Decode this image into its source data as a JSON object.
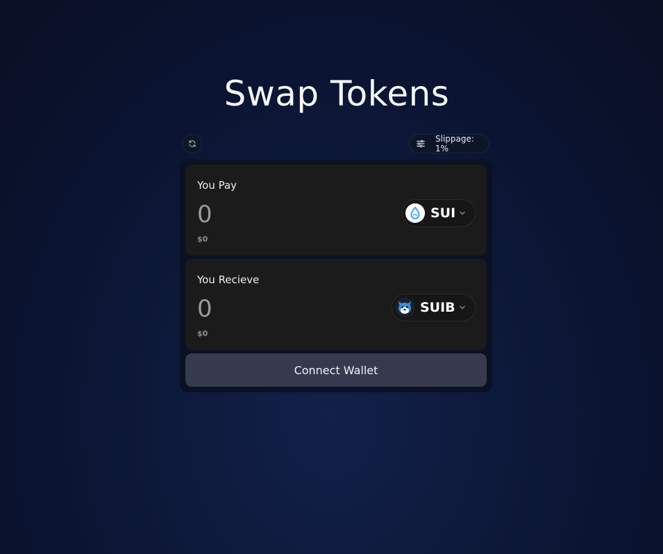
{
  "title": "Swap Tokens",
  "toolbar": {
    "refresh_icon": "refresh-icon",
    "slippage_icon": "sliders-icon",
    "slippage_label": "Slippage: 1%"
  },
  "pay": {
    "heading": "You Pay",
    "amount": "0",
    "usd": "$0",
    "token": {
      "symbol": "SUI",
      "icon": "sui-logo-icon",
      "icon_color": "#4da2ff"
    }
  },
  "receive": {
    "heading": "You Recieve",
    "amount": "0",
    "usd": "$0",
    "token": {
      "symbol": "SUIB",
      "icon": "suib-dog-logo-icon",
      "icon_color": "#3a8fd6"
    }
  },
  "connect_button": "Connect Wallet",
  "colors": {
    "background": "#0e1a3c",
    "panel": "#1b1b1c",
    "button": "#373a4f"
  }
}
